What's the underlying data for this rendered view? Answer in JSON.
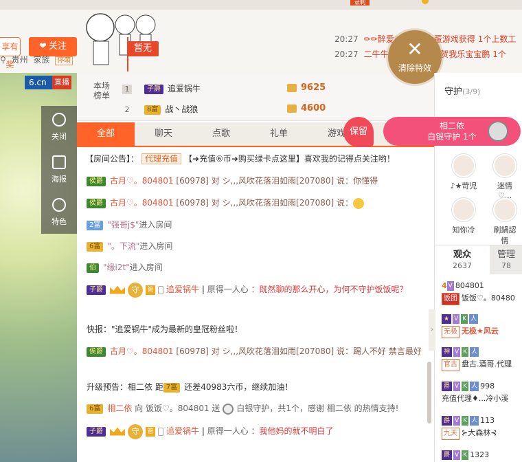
{
  "topbar": {
    "cut_label": "录制"
  },
  "header": {
    "fan_button": "享有奖",
    "follow_label": "关注",
    "location": [
      "贵州",
      "家族"
    ],
    "family_tag": "停萌",
    "no_star_label": "暂无",
    "notices": [
      {
        "time": "20:27",
        "text": "✏✏醉爱♡...玩砸金蛋游戏获得 1个上数工"
      },
      {
        "time": "20:27",
        "text": "二牛牛喜欢中 小牛牛贺我乐宝宝鹏 1个"
      }
    ],
    "clear_effects": "清除特效"
  },
  "video": {
    "brand": "6.cn",
    "live": "直播",
    "side_items": [
      {
        "icon": "power-icon",
        "label": "关闭"
      },
      {
        "icon": "poster-icon",
        "label": "海报"
      },
      {
        "icon": "effects-icon",
        "label": "特色"
      }
    ]
  },
  "rank": {
    "title": "本场榜单",
    "rows": [
      {
        "pos": "1",
        "badge": "子爵",
        "name": "追爱锅牛",
        "amount": "9625"
      },
      {
        "pos": "2",
        "badge": "8富",
        "name": "战丶战狼",
        "amount": "4600"
      }
    ]
  },
  "tabs": [
    "全部",
    "聊天",
    "点歌",
    "礼单",
    "游戏"
  ],
  "keep_label": "保留",
  "announcement": {
    "label": "【房间公告】：",
    "agent": "代理充值",
    "text": "【➜充值⑥币➜购买绿卡点这里】喜欢我的记得点关注哟！"
  },
  "messages": [
    {
      "badge": "侯爵",
      "user": "古月♡。804801",
      "rest": "[60978] 对 シ,,,风吹花落泪如雨[207080] 说：你懂得"
    },
    {
      "badge": "侯爵",
      "user": "古月♡。804801",
      "rest": "[60978] 对 シ,,,风吹花落泪如雨[207080] 说："
    },
    {
      "badge": "2富",
      "user": "\"强哥j$\"",
      "rest": "进入房间"
    },
    {
      "badge": "6富",
      "user": "\"。下流\"",
      "rest": "进入房间"
    },
    {
      "badge": "伯",
      "user": "\"缘i2t\"",
      "rest": "进入房间"
    },
    {
      "badge": "子爵",
      "user": "追爱锅牛",
      "mid": "原得一人心",
      "rest": "：既然聊的那么开心，为何不守护饭饭呢？"
    },
    {
      "text": "快报：\"追爱锅牛\"成为最新的皇冠粉丝啦！"
    },
    {
      "badge": "侯爵",
      "user": "古月♡。804801",
      "rest": "[60978] 对 シ,,,风吹花落泪如雨[207080] 说：踢人不好 禁言最好"
    },
    {
      "pre": "升级预告：相二依 距",
      "badge": "7富",
      "post": "还差40983六币，继续加油！"
    },
    {
      "badge": "6富",
      "user": "相二依",
      "mid": "向 饭饭♡。804801 送",
      "rest": "白银守护，共1个，感谢 相二依 的热情支持!"
    },
    {
      "badge": "子爵",
      "user": "追爱锅牛",
      "mid": "原得一人心",
      "rest": "：我他妈的就不明白了"
    }
  ],
  "guard": {
    "title": "守护",
    "count": "(3/9)",
    "members": [
      "♪★苛児",
      "迷情♡...",
      "知你冷",
      "刷鍋認情"
    ],
    "silver_banner": {
      "name": "相二依",
      "text": "白银守护 1个"
    }
  },
  "audience": {
    "tab_on": "观众",
    "tab_on_count": "2637",
    "tab_off": "管理",
    "tab_off_count": "78",
    "users": [
      {
        "prefix": "4",
        "name": "804801"
      },
      {
        "tag": "饭团",
        "name": "饭饭♡。80480"
      },
      {
        "tag": "无极",
        "name": "无极★风云"
      },
      {
        "tag": "官古",
        "name": "盘古.酒哥.代理"
      },
      {
        "name": "998"
      },
      {
        "name": "充值代理♦...冷小溪"
      },
      {
        "name": "113"
      },
      {
        "tag": "九天",
        "name": "⊱大森林⊰"
      },
      {
        "name": "1323"
      }
    ]
  }
}
